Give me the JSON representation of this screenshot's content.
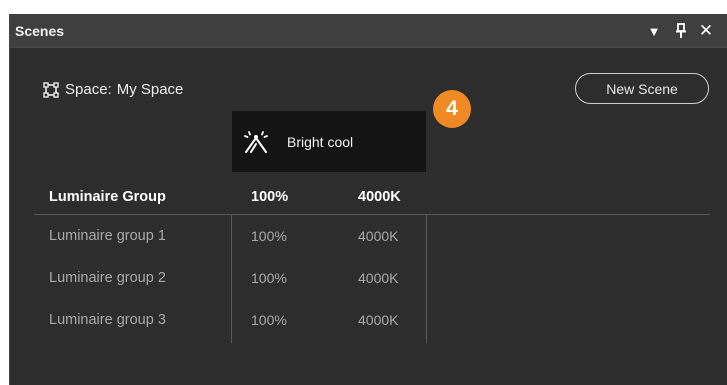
{
  "panel": {
    "title": "Scenes",
    "controls": {
      "dropdown": "▼",
      "pin": "ꟼ",
      "close": "✕"
    }
  },
  "space": {
    "prefix": "Space:",
    "name": "My Space",
    "icon": "space-frame-icon"
  },
  "toolbar": {
    "new_scene_label": "New Scene"
  },
  "badge": {
    "number": "4",
    "color": "#f08a24"
  },
  "scene": {
    "name": "Bright cool",
    "icon": "scene-rays-icon"
  },
  "table": {
    "headers": {
      "name": "Luminaire Group",
      "intensity": "100%",
      "cct": "4000K"
    },
    "rows": [
      {
        "name": "Luminaire group 1",
        "intensity": "100%",
        "cct": "4000K"
      },
      {
        "name": "Luminaire group 2",
        "intensity": "100%",
        "cct": "4000K"
      },
      {
        "name": "Luminaire group 3",
        "intensity": "100%",
        "cct": "4000K"
      }
    ]
  }
}
